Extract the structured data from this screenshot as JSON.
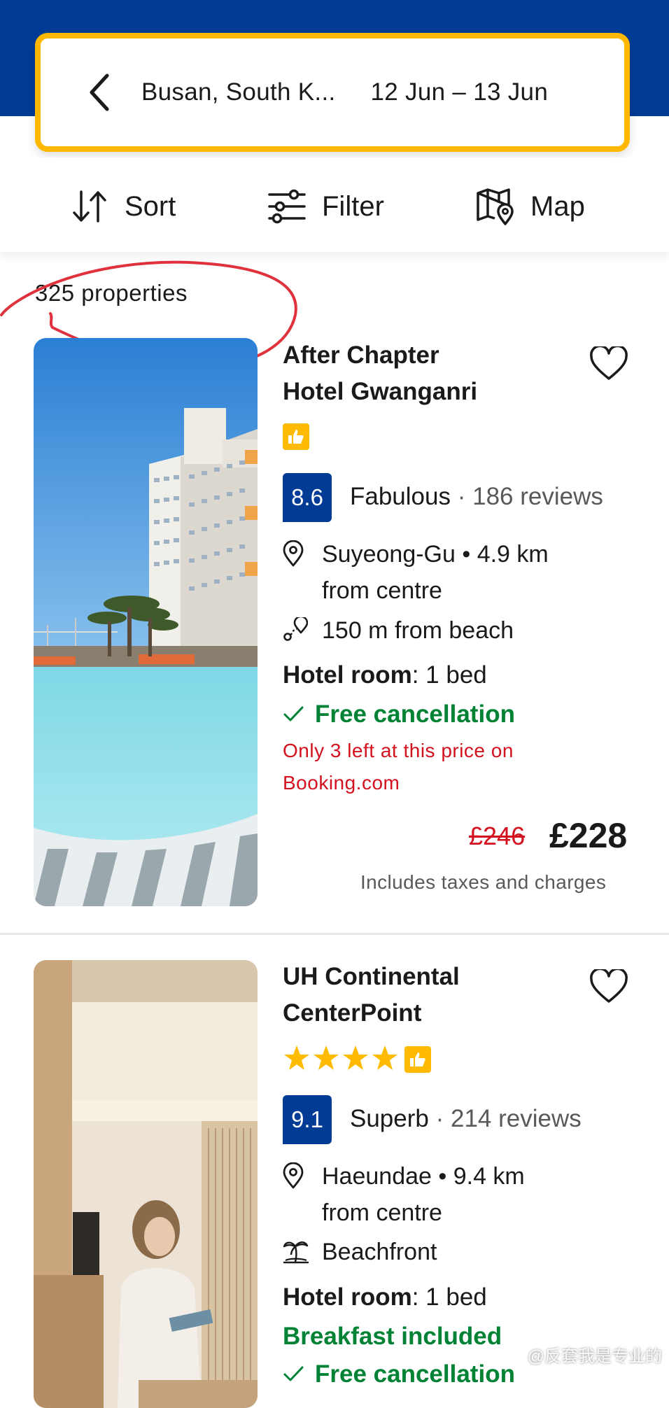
{
  "search": {
    "destination": "Busan, South K...",
    "dates": "12 Jun  –  13 Jun"
  },
  "toolbar": {
    "sort_label": "Sort",
    "filter_label": "Filter",
    "map_label": "Map"
  },
  "results": {
    "count": "325 properties"
  },
  "colors": {
    "brand_blue": "#003b95",
    "search_border": "#ffb700",
    "green": "#008234",
    "red": "#d4111e",
    "annotation": "#e0323c"
  },
  "hotels": [
    {
      "name_line1": "After Chapter",
      "name_line2": "Hotel Gwanganri",
      "score": "8.6",
      "rating_word": "Fabulous",
      "reviews": "· 186 reviews",
      "location_line1": "Suyeong-Gu • 4.9 km",
      "location_line2": "from centre",
      "beach": "150 m from beach",
      "room_type": "Hotel room",
      "room_beds": ": 1 bed",
      "free_cancellation": "Free cancellation",
      "scarcity_line1": "Only 3 left at this price on",
      "scarcity_line2": "Booking.com",
      "old_price": "£246",
      "price": "£228",
      "taxes": "Includes taxes and charges"
    },
    {
      "name_line1": "UH Continental",
      "name_line2": "CenterPoint",
      "stars": 4,
      "score": "9.1",
      "rating_word": "Superb",
      "reviews": "· 214 reviews",
      "location_line1": "Haeundae • 9.4 km",
      "location_line2": "from centre",
      "beach": "Beachfront",
      "room_type": "Hotel room",
      "room_beds": ": 1 bed",
      "breakfast": "Breakfast included",
      "free_cancellation": "Free cancellation"
    }
  ],
  "watermark": "@反套我是专业的"
}
